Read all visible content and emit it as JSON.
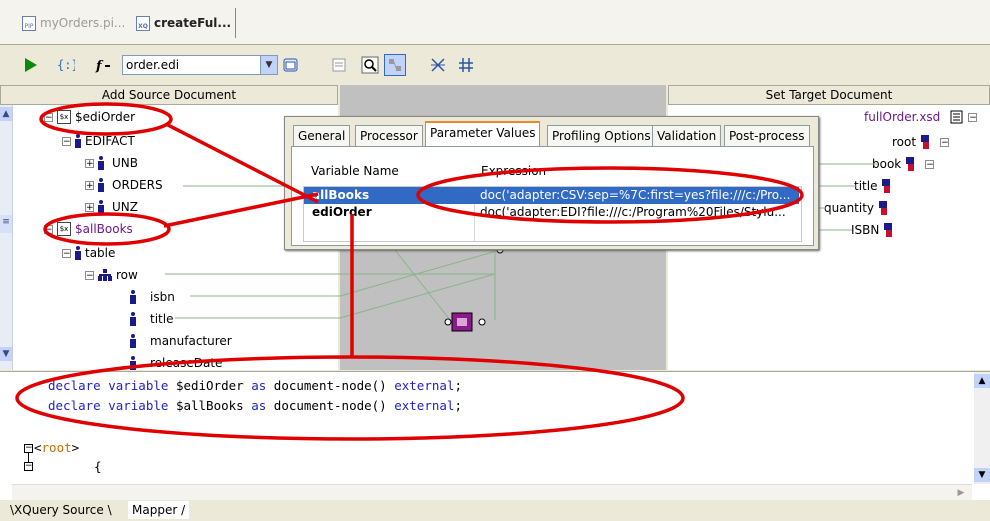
{
  "tabs": [
    {
      "label": "myOrders.pi...",
      "icon": "pip-file-icon",
      "icon_text": "PIP"
    },
    {
      "label": "createFul...",
      "icon": "xq-file-icon",
      "icon_text": "XQ"
    }
  ],
  "toolbar": {
    "combo_value": "order.edi"
  },
  "source": {
    "header": "Add Source Document",
    "nodes": [
      {
        "label": "$ediOrder"
      },
      {
        "label": "EDIFACT"
      },
      {
        "label": "UNB"
      },
      {
        "label": "ORDERS"
      },
      {
        "label": "UNZ"
      },
      {
        "label": "$allBooks"
      },
      {
        "label": "table"
      },
      {
        "label": "row"
      },
      {
        "label": "isbn"
      },
      {
        "label": "title"
      },
      {
        "label": "manufacturer"
      },
      {
        "label": "releaseDate"
      }
    ]
  },
  "target": {
    "header": "Set Target Document",
    "file": "fullOrder.xsd",
    "nodes": [
      {
        "label": "root"
      },
      {
        "label": "book"
      },
      {
        "label": "title"
      },
      {
        "label": "quantity"
      },
      {
        "label": "ISBN"
      }
    ]
  },
  "dialog": {
    "tabs": [
      "General",
      "Processor",
      "Parameter Values",
      "Profiling Options",
      "Validation",
      "Post-process"
    ],
    "selected_tab": "Parameter Values",
    "columns": [
      "Variable Name",
      "Expression"
    ],
    "rows": [
      {
        "name": "allBooks",
        "expression": "doc('adapter:CSV:sep=%7C:first=yes?file:///c:/Pro...",
        "selected": true
      },
      {
        "name": "ediOrder",
        "expression": "doc('adapter:EDI?file:///c:/Program%20Files/Stylu...",
        "selected": false
      }
    ]
  },
  "editor": {
    "line1": {
      "kw1": "declare variable",
      "var": " $ediOrder ",
      "kw2": "as",
      "type": " document-node() ",
      "kw3": "external",
      "end": ";"
    },
    "line2": {
      "kw1": "declare variable",
      "var": " $allBooks ",
      "kw2": "as",
      "type": " document-node() ",
      "kw3": "external",
      "end": ";"
    },
    "line3_open": "<",
    "line3_tag": "root",
    "line3_close": ">",
    "line4": "{"
  },
  "bottom_tabs": [
    "XQuery Source",
    "Mapper"
  ],
  "colors": {
    "highlight": "#e00000",
    "selection": "#316ac5",
    "keyword": "#2222cc",
    "tag": "#c07000"
  }
}
